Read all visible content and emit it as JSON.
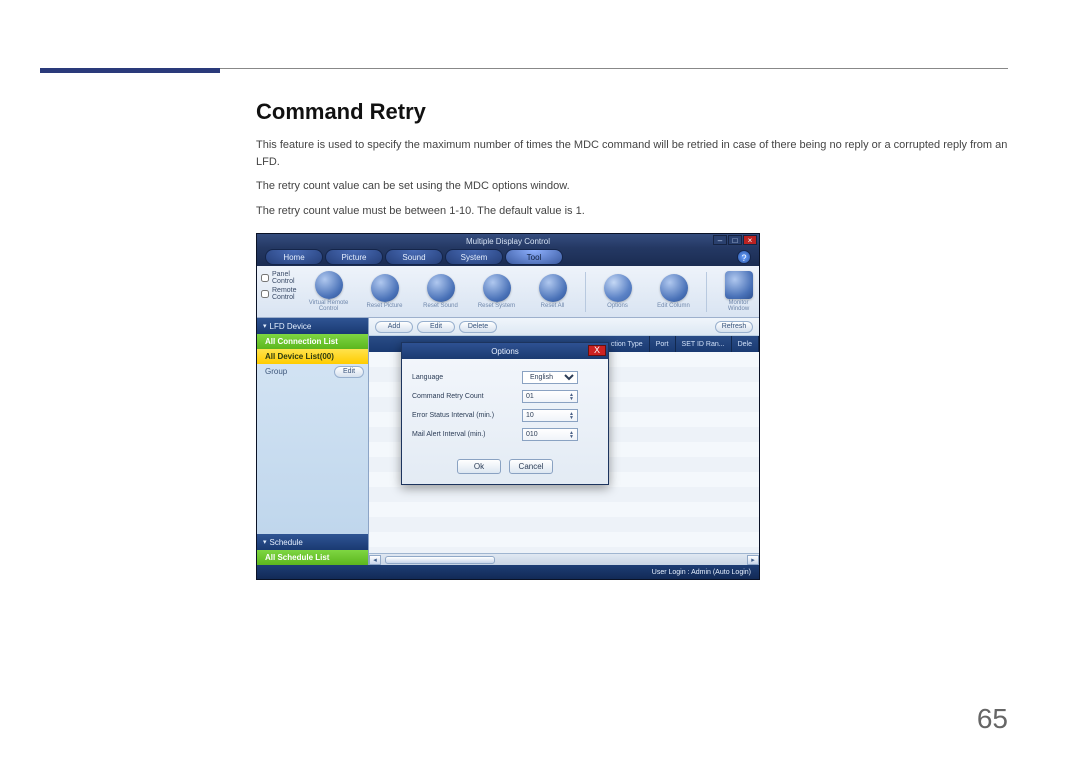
{
  "doc": {
    "heading": "Command Retry",
    "p1": "This feature is used to specify the maximum number of times the MDC command will be retried in case of there being no reply or a corrupted reply from an LFD.",
    "p2": "The retry count value can be set using the MDC options window.",
    "p3": "The retry count value must be between 1-10. The default value is 1.",
    "page_num": "65"
  },
  "app": {
    "title": "Multiple Display Control",
    "menus": [
      "Home",
      "Picture",
      "Sound",
      "System",
      "Tool"
    ],
    "active_menu": 4,
    "left_checks": [
      "Panel Control",
      "Remote Control"
    ],
    "tool_icons": [
      {
        "label": "Virtual Remote\nControl"
      },
      {
        "label": "Reset Picture"
      },
      {
        "label": "Reset Sound"
      },
      {
        "label": "Reset System"
      },
      {
        "label": "Reset All"
      },
      {
        "label": "Options",
        "gear": true
      },
      {
        "label": "Edit Column"
      },
      {
        "label": "Monitor\nWindow",
        "monitor": true
      }
    ],
    "sidebar": {
      "hdr1": "LFD Device",
      "green1": "All Connection List",
      "yellow": "All Device List(00)",
      "group_label": "Group",
      "group_btn": "Edit",
      "hdr2": "Schedule",
      "green2": "All Schedule List"
    },
    "actions": {
      "add": "Add",
      "edit": "Edit",
      "delete": "Delete",
      "refresh": "Refresh"
    },
    "columns": [
      "ction Type",
      "Port",
      "SET ID Ran...",
      "Dele"
    ],
    "status": "User Login : Admin (Auto Login)"
  },
  "modal": {
    "title": "Options",
    "rows": [
      {
        "label": "Language",
        "value": "English",
        "type": "select"
      },
      {
        "label": "Command Retry Count",
        "value": "01",
        "type": "num"
      },
      {
        "label": "Error Status Interval (min.)",
        "value": "10",
        "type": "num"
      },
      {
        "label": "Mail Alert Interval (min.)",
        "value": "010",
        "type": "num"
      }
    ],
    "ok": "Ok",
    "cancel": "Cancel"
  }
}
